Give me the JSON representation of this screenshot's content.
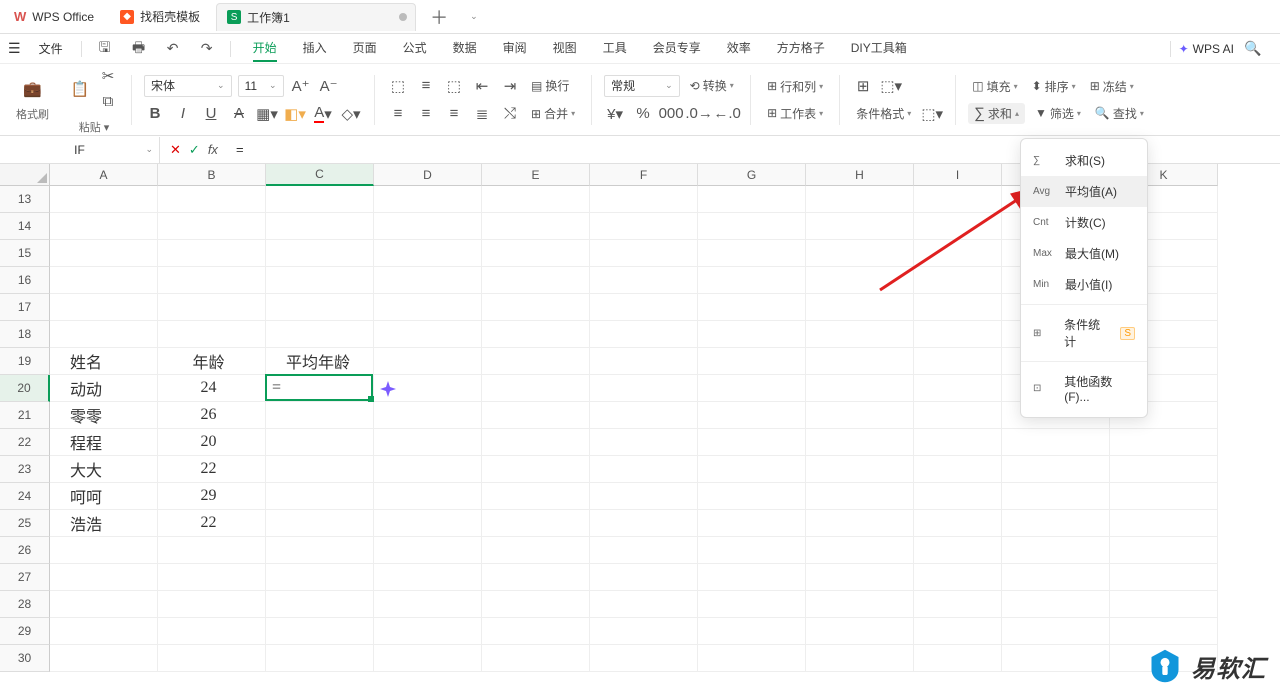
{
  "titleTabs": {
    "wps": "WPS Office",
    "template": "找稻壳模板",
    "doc": "工作簿1"
  },
  "menu": {
    "file": "文件",
    "tabs": [
      "开始",
      "插入",
      "页面",
      "公式",
      "数据",
      "审阅",
      "视图",
      "工具",
      "会员专享",
      "效率",
      "方方格子",
      "DIY工具箱"
    ],
    "ai": "WPS AI"
  },
  "ribbon": {
    "brush": "格式刷",
    "paste": "粘贴",
    "font": "宋体",
    "size": "11",
    "wrap": "换行",
    "merge": "合并",
    "numfmt": "常规",
    "convert": "转换",
    "rowcol": "行和列",
    "worksheet": "工作表",
    "cond": "条件格式",
    "fill": "填充",
    "sum": "求和",
    "sort": "排序",
    "filter": "筛选",
    "freeze": "冻结",
    "find": "查找"
  },
  "fbar": {
    "name": "IF",
    "val": "="
  },
  "columns": [
    "A",
    "B",
    "C",
    "D",
    "E",
    "F",
    "G",
    "H",
    "I",
    "J",
    "K"
  ],
  "rowStart": 13,
  "rowEnd": 30,
  "selRow": 20,
  "selCol": "C",
  "cells": {
    "A19": "姓名",
    "B19": "年龄",
    "C19": "平均年龄",
    "A20": "动动",
    "B20": "24",
    "C20": "=",
    "A21": "零零",
    "B21": "26",
    "A22": "程程",
    "B22": "20",
    "A23": "大大",
    "B23": "22",
    "A24": "呵呵",
    "B24": "29",
    "A25": "浩浩",
    "B25": "22"
  },
  "dd": {
    "sum": "求和(S)",
    "avg": "平均值(A)",
    "cnt": "计数(C)",
    "max": "最大值(M)",
    "min": "最小值(I)",
    "cond": "条件统计",
    "other": "其他函数(F)..."
  },
  "watermark": "易软汇"
}
